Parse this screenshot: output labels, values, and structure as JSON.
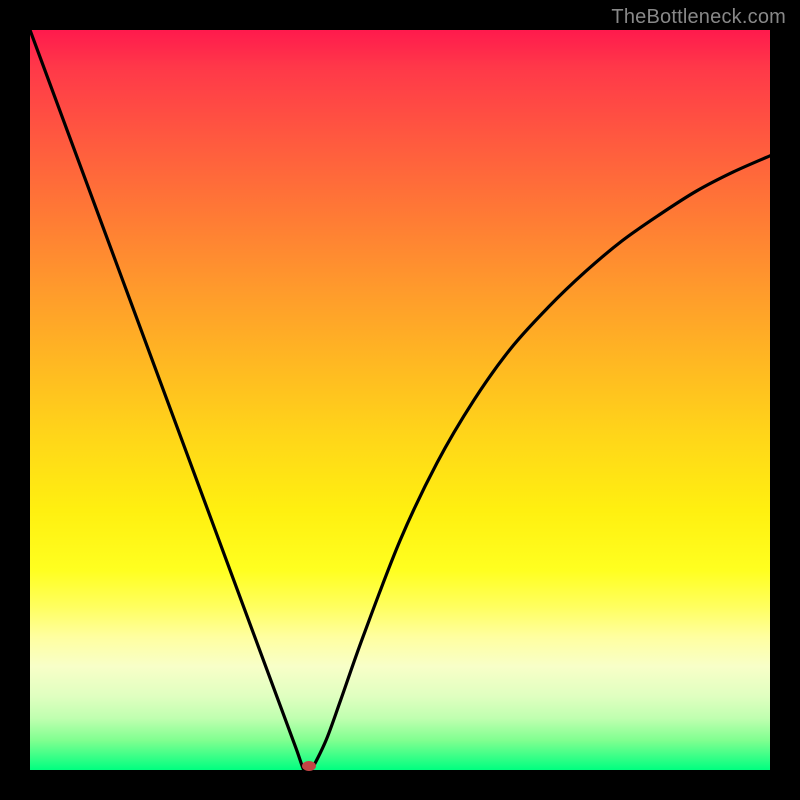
{
  "watermark": "TheBottleneck.com",
  "chart_data": {
    "type": "line",
    "title": "",
    "xlabel": "",
    "ylabel": "",
    "xlim": [
      0,
      100
    ],
    "ylim": [
      0,
      100
    ],
    "grid": false,
    "series": [
      {
        "name": "curve",
        "x": [
          0,
          5,
          10,
          15,
          20,
          25,
          30,
          34,
          36,
          37,
          37.5,
          38,
          40,
          42,
          45,
          50,
          55,
          60,
          65,
          70,
          75,
          80,
          85,
          90,
          95,
          100
        ],
        "values": [
          100,
          86.5,
          73,
          59.5,
          46,
          32.5,
          19,
          8.2,
          2.8,
          0,
          0,
          0,
          4,
          9.5,
          18,
          31,
          41.5,
          50,
          57,
          62.5,
          67.3,
          71.5,
          75,
          78.2,
          80.8,
          83
        ]
      }
    ],
    "marker": {
      "x": 37.7,
      "y": 0.5
    },
    "gradient_stops": [
      {
        "pos": 0,
        "color": "#ff1a4d"
      },
      {
        "pos": 50,
        "color": "#ffd619"
      },
      {
        "pos": 80,
        "color": "#ffff60"
      },
      {
        "pos": 100,
        "color": "#00ff80"
      }
    ]
  }
}
